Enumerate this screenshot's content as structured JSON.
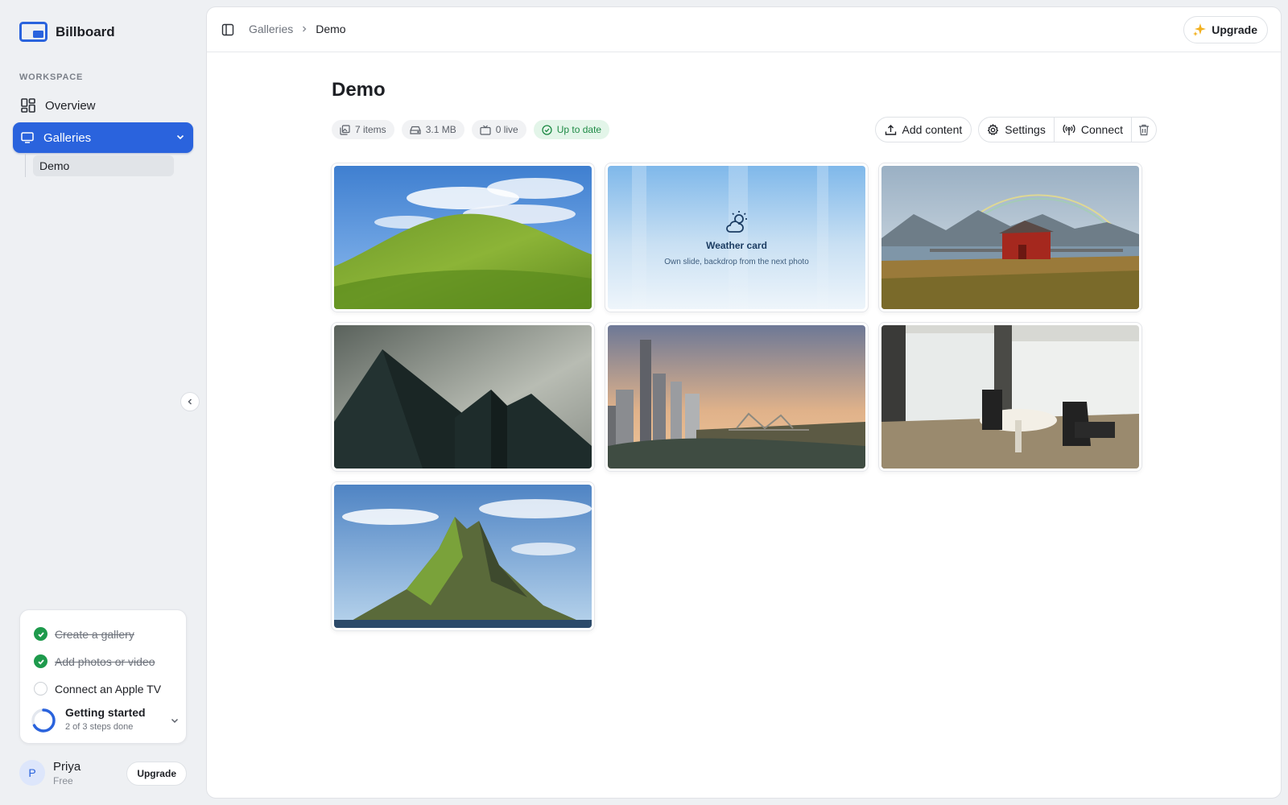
{
  "app": {
    "name": "Billboard"
  },
  "sidebar": {
    "section_label": "WORKSPACE",
    "items": [
      {
        "label": "Overview",
        "icon": "grid-icon"
      },
      {
        "label": "Galleries",
        "icon": "monitor-icon",
        "active": true
      }
    ],
    "sub_items": [
      {
        "label": "Demo"
      }
    ]
  },
  "checklist": {
    "steps": [
      {
        "label": "Create a gallery",
        "done": true
      },
      {
        "label": "Add photos or video",
        "done": true
      },
      {
        "label": "Connect an Apple TV",
        "done": false
      }
    ],
    "title": "Getting started",
    "subtitle": "2 of 3 steps done",
    "progress": 0.667
  },
  "user": {
    "initial": "P",
    "name": "Priya",
    "plan": "Free",
    "upgrade_label": "Upgrade"
  },
  "topbar": {
    "breadcrumb": [
      "Galleries",
      "Demo"
    ],
    "upgrade_label": "Upgrade"
  },
  "page": {
    "title": "Demo",
    "stats": {
      "items": "7 items",
      "size": "3.1 MB",
      "live": "0 live",
      "status": "Up to date"
    },
    "actions": {
      "add_content": "Add content",
      "settings": "Settings",
      "connect": "Connect"
    }
  },
  "gallery": {
    "tiles": [
      {
        "kind": "photo",
        "subject": "green hillside under blue sky"
      },
      {
        "kind": "weather",
        "title": "Weather card",
        "subtitle": "Own slide, backdrop from the next photo"
      },
      {
        "kind": "photo",
        "subject": "red cabin by lake with rainbow"
      },
      {
        "kind": "photo",
        "subject": "dark angular building facade"
      },
      {
        "kind": "photo",
        "subject": "city skyline with river and bridge"
      },
      {
        "kind": "photo",
        "subject": "office with round table overlooking city"
      },
      {
        "kind": "photo",
        "subject": "rocky green island in the sea"
      }
    ]
  },
  "colors": {
    "accent": "#2a63dd",
    "success": "#1e9a4c",
    "sidebar_bg": "#eef0f3"
  }
}
